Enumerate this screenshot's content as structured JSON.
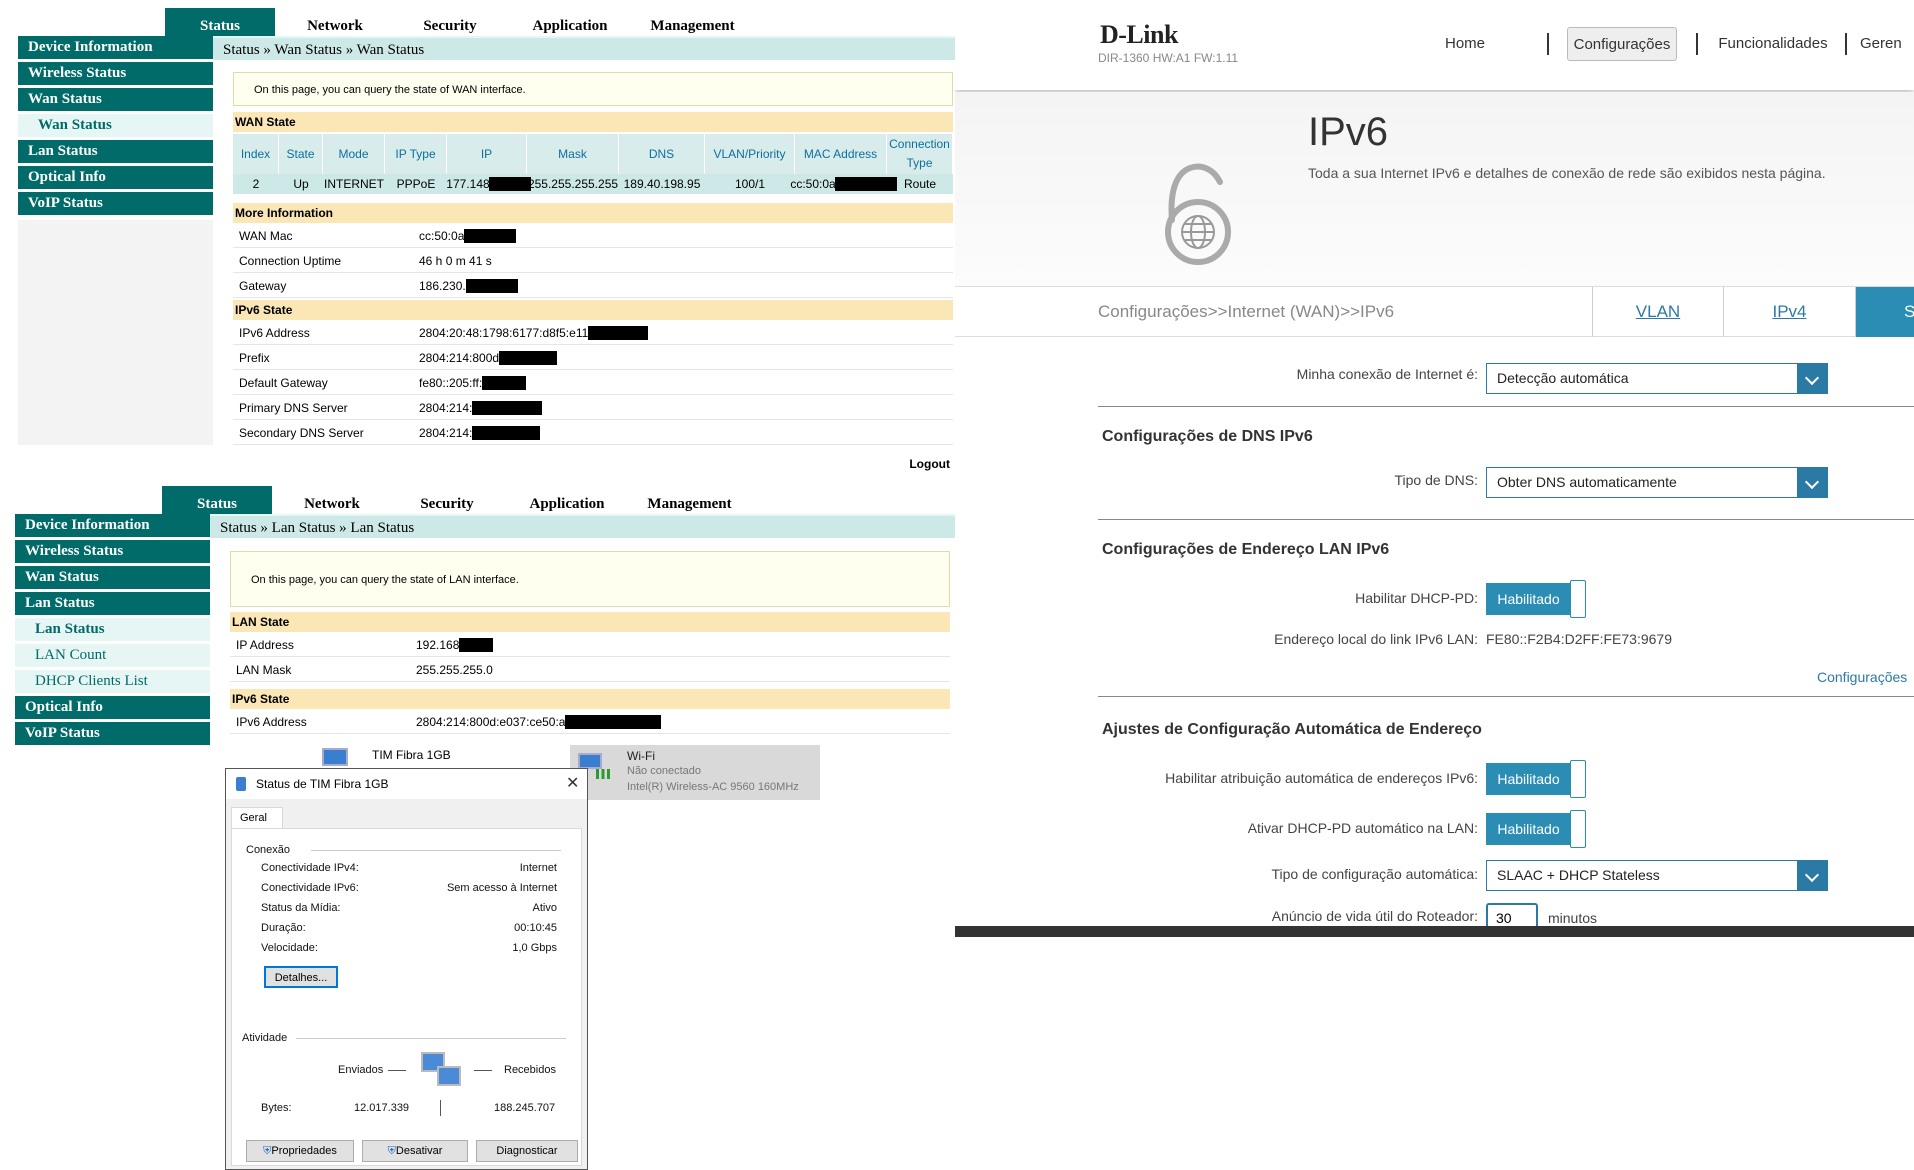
{
  "wan_panel": {
    "tabs": [
      "Status",
      "Network",
      "Security",
      "Application",
      "Management"
    ],
    "sidebar": [
      "Device Information",
      "Wireless Status",
      "Wan Status",
      "Wan Status",
      "Lan Status",
      "Optical Info",
      "VoIP Status"
    ],
    "breadcrumb": "Status » Wan Status » Wan Status",
    "note": "On this page, you can query the state of WAN interface.",
    "wan_state_title": "WAN State",
    "wan_headers": [
      "Index",
      "State",
      "Mode",
      "IP Type",
      "IP",
      "Mask",
      "DNS",
      "VLAN/Priority",
      "MAC Address",
      "Connection Type"
    ],
    "wan_row": [
      "2",
      "Up",
      "INTERNET",
      "PPPoE",
      "177.148",
      "255.255.255.255",
      "189.40.198.95",
      "100/1",
      "cc:50:0a",
      "Route"
    ],
    "more_title": "More Information",
    "more": [
      {
        "k": "WAN Mac",
        "v": "cc:50:0a"
      },
      {
        "k": "Connection Uptime",
        "v": "46 h 0 m 41 s"
      },
      {
        "k": "Gateway",
        "v": "186.230."
      }
    ],
    "ipv6_title": "IPv6 State",
    "ipv6": [
      {
        "k": "IPv6 Address",
        "v": "2804:20:48:1798:6177:d8f5:e11"
      },
      {
        "k": "Prefix",
        "v": "2804:214:800d"
      },
      {
        "k": "Default Gateway",
        "v": "fe80::205:ff:"
      },
      {
        "k": "Primary DNS Server",
        "v": "2804:214:"
      },
      {
        "k": "Secondary DNS Server",
        "v": "2804:214:"
      }
    ],
    "logout": "Logout"
  },
  "lan_panel": {
    "tabs": [
      "Status",
      "Network",
      "Security",
      "Application",
      "Management"
    ],
    "sidebar": [
      "Device Information",
      "Wireless Status",
      "Wan Status",
      "Lan Status",
      "Lan Status",
      "LAN Count",
      "DHCP Clients List",
      "Optical Info",
      "VoIP Status"
    ],
    "breadcrumb": "Status » Lan Status » Lan Status",
    "note": "On this page, you can query the state of LAN interface.",
    "lan_title": "LAN State",
    "lan": [
      {
        "k": "IP Address",
        "v": "192.168"
      },
      {
        "k": "LAN Mask",
        "v": "255.255.255.0"
      }
    ],
    "ipv6_title": "IPv6 State",
    "ipv6": [
      {
        "k": "IPv6 Address",
        "v": "2804:214:800d:e037:ce50:a"
      }
    ]
  },
  "network_strip": {
    "tim": "TIM Fibra 1GB",
    "wifi_name": "Wi-Fi",
    "wifi_status": "Não conectado",
    "wifi_adapter": "Intel(R) Wireless-AC 9560 160MHz"
  },
  "win_dialog": {
    "title": "Status de TIM Fibra 1GB",
    "tab": "Geral",
    "connection_label": "Conexão",
    "rows": [
      {
        "k": "Conectividade IPv4:",
        "v": "Internet"
      },
      {
        "k": "Conectividade IPv6:",
        "v": "Sem acesso à Internet"
      },
      {
        "k": "Status da Mídia:",
        "v": "Ativo"
      },
      {
        "k": "Duração:",
        "v": "00:10:45"
      },
      {
        "k": "Velocidade:",
        "v": "1,0 Gbps"
      }
    ],
    "details": "Detalhes...",
    "activity_label": "Atividade",
    "sent": "Enviados",
    "received": "Recebidos",
    "bytes_label": "Bytes:",
    "bytes_sent": "12.017.339",
    "bytes_received": "188.245.707",
    "buttons": [
      "Propriedades",
      "Desativar",
      "Diagnosticar"
    ]
  },
  "dlink": {
    "logo": "D-Link",
    "model": "DIR-1360 HW:A1 FW:1.11",
    "nav": [
      "Home",
      "Configurações",
      "Funcionalidades",
      "Geren"
    ],
    "page_title": "IPv6",
    "page_desc": "Toda a sua Internet IPv6 e detalhes de conexão de rede são exibidos nesta página.",
    "breadcrumb": "Configurações>>Internet (WAN)>>IPv6",
    "tabs": [
      "VLAN",
      "IPv4",
      "S"
    ],
    "conn_label": "Minha conexão de Internet é:",
    "conn_value": "Detecção automática",
    "dns_section": "Configurações de DNS IPv6",
    "dns_label": "Tipo de DNS:",
    "dns_value": "Obter DNS automaticamente",
    "lan_section": "Configurações de Endereço LAN IPv6",
    "dhcppd_label": "Habilitar DHCP-PD:",
    "enabled": "Habilitado",
    "linklocal_label": "Endereço local do link IPv6 LAN:",
    "linklocal_value": "FE80::F2B4:D2FF:FE73:9679",
    "more_link": "Configurações",
    "auto_section": "Ajustes de Configuração Automática de Endereço",
    "auto_assign_label": "Habilitar atribuição automática de endereços IPv6:",
    "auto_dhcppd_label": "Ativar DHCP-PD automático na LAN:",
    "auto_type_label": "Tipo de configuração automática:",
    "auto_type_value": "SLAAC + DHCP Stateless",
    "lifetime_label": "Anúncio de vida útil do Roteador:",
    "lifetime_value": "30",
    "lifetime_unit": "minutos"
  },
  "colors": {
    "ont_green": "#006b68",
    "dlink_blue": "#2b8db4",
    "highlight_row": "#cde9e7"
  }
}
